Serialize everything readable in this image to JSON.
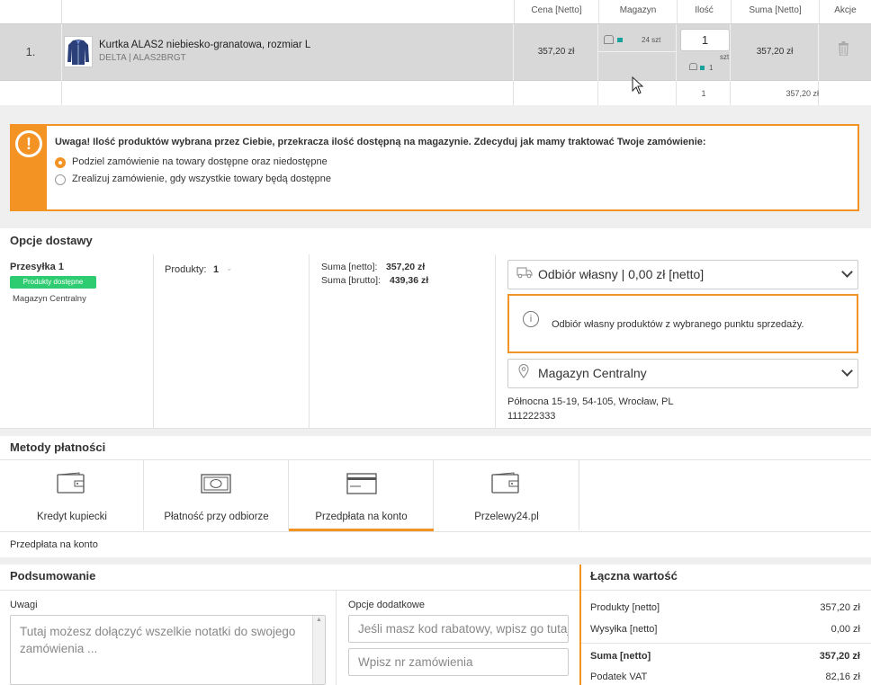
{
  "table": {
    "headers": {
      "price": "Cena [Netto]",
      "warehouse": "Magazyn",
      "qty": "Ilość",
      "sum": "Suma [Netto]",
      "actions": "Akcje"
    },
    "row": {
      "index": "1.",
      "name": "Kurtka ALAS2 niebiesko-granatowa, rozmiar L",
      "sku": "DELTA | ALAS2BRGT",
      "price": "357,20 zł",
      "stock": "24 szt",
      "qty_value": "1",
      "qty_unit": "szt",
      "qty_available": "1",
      "sum": "357,20 zł"
    },
    "subtotal": {
      "qty": "1",
      "sum": "357,20 zł"
    }
  },
  "warning": {
    "icon": "exclamation-icon",
    "title": "Uwaga! Ilość produktów wybrana przez Ciebie, przekracza ilość dostępną na magazynie. Zdecyduj jak mamy traktować Twoje zamówienie:",
    "options": [
      {
        "label": "Podziel zamówienie na towary dostępne oraz niedostępne",
        "selected": true
      },
      {
        "label": "Zrealizuj zamówienie, gdy wszystkie towary będą dostępne",
        "selected": false
      }
    ]
  },
  "delivery": {
    "title": "Opcje dostawy",
    "shipment": "Przesyłka 1",
    "badge": "Produkty dostępne",
    "warehouse": "Magazyn Centralny",
    "products_label": "Produkty:",
    "products_count": "1",
    "sum_net_label": "Suma [netto]:",
    "sum_net": "357,20 zł",
    "sum_gross_label": "Suma [brutto]:",
    "sum_gross": "439,36 zł",
    "method": "Odbiór własny | 0,00 zł [netto]",
    "info": "Odbiór własny produktów z wybranego punktu sprzedaży.",
    "point": "Magazyn Centralny",
    "address": "Północna 15-19, 54-105, Wrocław, PL",
    "phone": "111222333"
  },
  "payments": {
    "title": "Metody płatności",
    "methods": [
      {
        "label": "Kredyt kupiecki",
        "icon": "wallet-icon"
      },
      {
        "label": "Płatność przy odbiorze",
        "icon": "cash-icon"
      },
      {
        "label": "Przedpłata na konto",
        "icon": "card-icon"
      },
      {
        "label": "Przelewy24.pl",
        "icon": "wallet-icon"
      }
    ],
    "selected": "Przedpłata na konto"
  },
  "summary": {
    "title": "Podsumowanie",
    "notes_label": "Uwagi",
    "notes_placeholder": "Tutaj możesz dołączyć wszelkie notatki do swojego zamówienia ...",
    "extra_label": "Opcje dodatkowe",
    "coupon_placeholder": "Jeśli masz kod rabatowy, wpisz go tutaj",
    "order_no_placeholder": "Wpisz nr zamówienia"
  },
  "totals": {
    "title": "Łączna wartość",
    "rows": [
      {
        "label": "Produkty [netto]",
        "value": "357,20 zł"
      },
      {
        "label": "Wysyłka [netto]",
        "value": "0,00 zł"
      },
      {
        "label": "Suma [netto]",
        "value": "357,20 zł"
      },
      {
        "label": "Podatek VAT",
        "value": "82,16 zł"
      }
    ]
  },
  "colors": {
    "accent": "#f39324",
    "success": "#2ecc71",
    "teal": "#19a29b"
  }
}
